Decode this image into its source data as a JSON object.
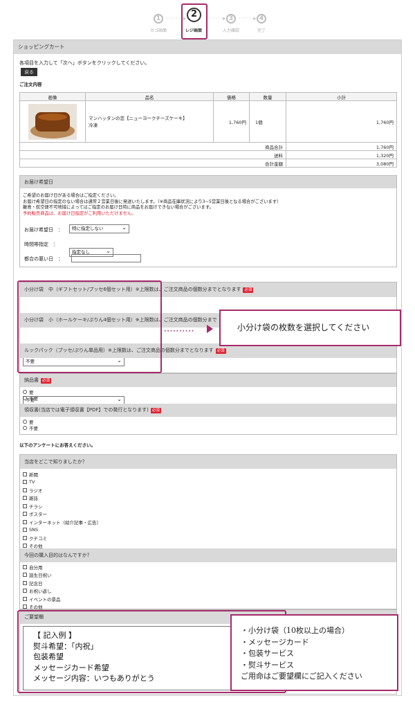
{
  "steps": [
    {
      "num": "1",
      "label": "カゴ画面"
    },
    {
      "num": "2",
      "label": "レジ画面"
    },
    {
      "num": "3",
      "label": "入力確認"
    },
    {
      "num": "4",
      "label": "完了"
    }
  ],
  "cart": {
    "title": "ショッピングカート",
    "intro": "各項目を入力して「次へ」ボタンをクリックしてください。",
    "back": "戻る",
    "order_heading": "ご注文内容",
    "headers": [
      "画像",
      "品名",
      "価格",
      "数量",
      "小計"
    ],
    "item": {
      "name": "マンハッタンの恋【ニューヨークチーズケーキ】",
      "temp": "冷凍",
      "price": "1,760円",
      "qty": "1個",
      "subtotal": "1,760円"
    },
    "totals": [
      {
        "label": "商品合計",
        "value": "1,760円"
      },
      {
        "label": "送料",
        "value": "1,320円"
      },
      {
        "label": "合計金額",
        "value": "3,080円"
      }
    ]
  },
  "delivery": {
    "title": "お届け希望日",
    "notes": [
      "ご希望のお届け日がある場合はご指定ください。",
      "お届け希望日の指定のない場合は通常２営業日後に発送いたします。（※商品在庫状況により3~5営業日後となる場合がございます）",
      "離島・航空便不可地域によってはご指定のお届け日時に商品をお届けできない場合がございます。"
    ],
    "note_red": "予約販売商品は、お届け日指定がご利用いただけません。",
    "fields": [
      {
        "label": "お届け希望日　：",
        "value": "特に指定しない"
      },
      {
        "label": "時間帯指定　：",
        "value": "指定なし"
      },
      {
        "label": "都合の悪い日　："
      }
    ]
  },
  "bags": [
    {
      "label": "小分け袋　中（ギフトセット/プッセ6個セット用）※上限数は、ご注文商品の個数分までとなります",
      "value": "不要"
    },
    {
      "label": "小分け袋　小（ホールケーキ/ぷりん4個セット用）※上限数は、ご注文商品の個数分まで",
      "value": "不要"
    },
    {
      "label": "ルックパック（プッセ/ぷりん単品用）※上限数は、ご注文商品の個数分までとなります",
      "value": "不要"
    }
  ],
  "required": "必須",
  "invoice": {
    "title": "納品書",
    "options": [
      "要",
      "不要"
    ]
  },
  "receipt": {
    "title": "領収書(当店では電子領収書【PDF】での発行となります)",
    "options": [
      "要",
      "不要"
    ]
  },
  "survey_intro": "以下のアンケートにお答えください。",
  "q1": {
    "title": "当店をどこで知りましたか？",
    "options": [
      "新聞",
      "TV",
      "ラジオ",
      "雑誌",
      "チラシ",
      "ポスター",
      "インターネット（紹介記事・広告）",
      "SNS",
      "クチコミ",
      "その他"
    ]
  },
  "q2": {
    "title": "今回の購入目的はなんですか？",
    "options": [
      "自分用",
      "誕生日祝い",
      "記念日",
      "お祝い返し",
      "イベントの景品",
      "その他"
    ]
  },
  "request": {
    "title": "ご要望欄",
    "example": [
      "【 記入例 】",
      "熨斗希望：「内祝」",
      "包装希望",
      "メッセージカード希望",
      "メッセージ内容：いつもありがとう"
    ]
  },
  "callout1": "小分け袋の枚数を選択してください",
  "callout2": [
    "・小分け袋（10枚以上の場合）",
    "・メッセージカード",
    "・包装サービス",
    "・熨斗サービス",
    "ご用命はご要望欄にご記入ください"
  ]
}
